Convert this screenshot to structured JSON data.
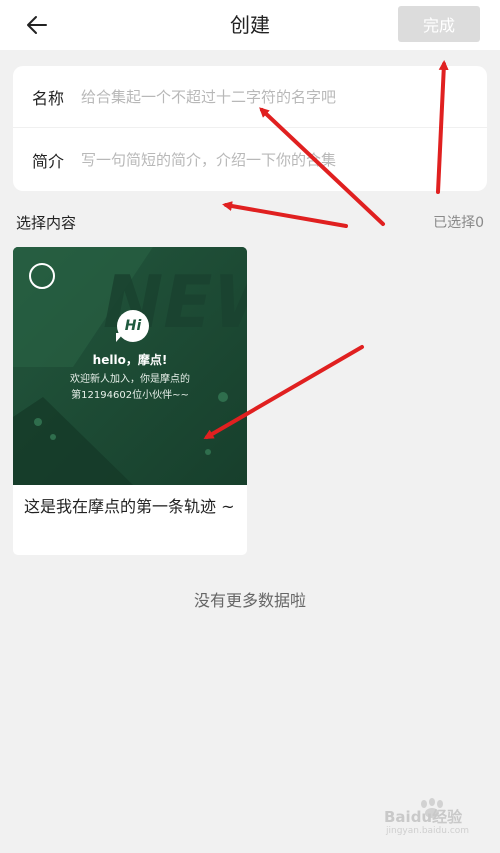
{
  "header": {
    "title": "创建",
    "done_label": "完成"
  },
  "form": {
    "name_label": "名称",
    "name_placeholder": "给合集起一个不超过十二字符的名字吧",
    "intro_label": "简介",
    "intro_placeholder": "写一句简短的简介，介绍一下你的合集"
  },
  "content": {
    "section_title": "选择内容",
    "selected_count": "已选择0",
    "items": [
      {
        "thumb_bubble": "Hi",
        "thumb_bg_word": "NEW",
        "thumb_line1": "hello，摩点!",
        "thumb_line2": "欢迎新人加入，你是摩点的",
        "thumb_line3": "第12194602位小伙伴~~",
        "caption": "这是我在摩点的第一条轨迹 ~",
        "selected": false
      }
    ]
  },
  "footer": {
    "no_more_text": "没有更多数据啦"
  },
  "watermark": {
    "text": "Baidu经验",
    "sub": "jingyan.baidu.com"
  },
  "colors": {
    "background": "#f1f1f1",
    "done_disabled": "#dcdcdc",
    "thumb_green": "#1c4a34",
    "annotation_red": "#e02020"
  }
}
